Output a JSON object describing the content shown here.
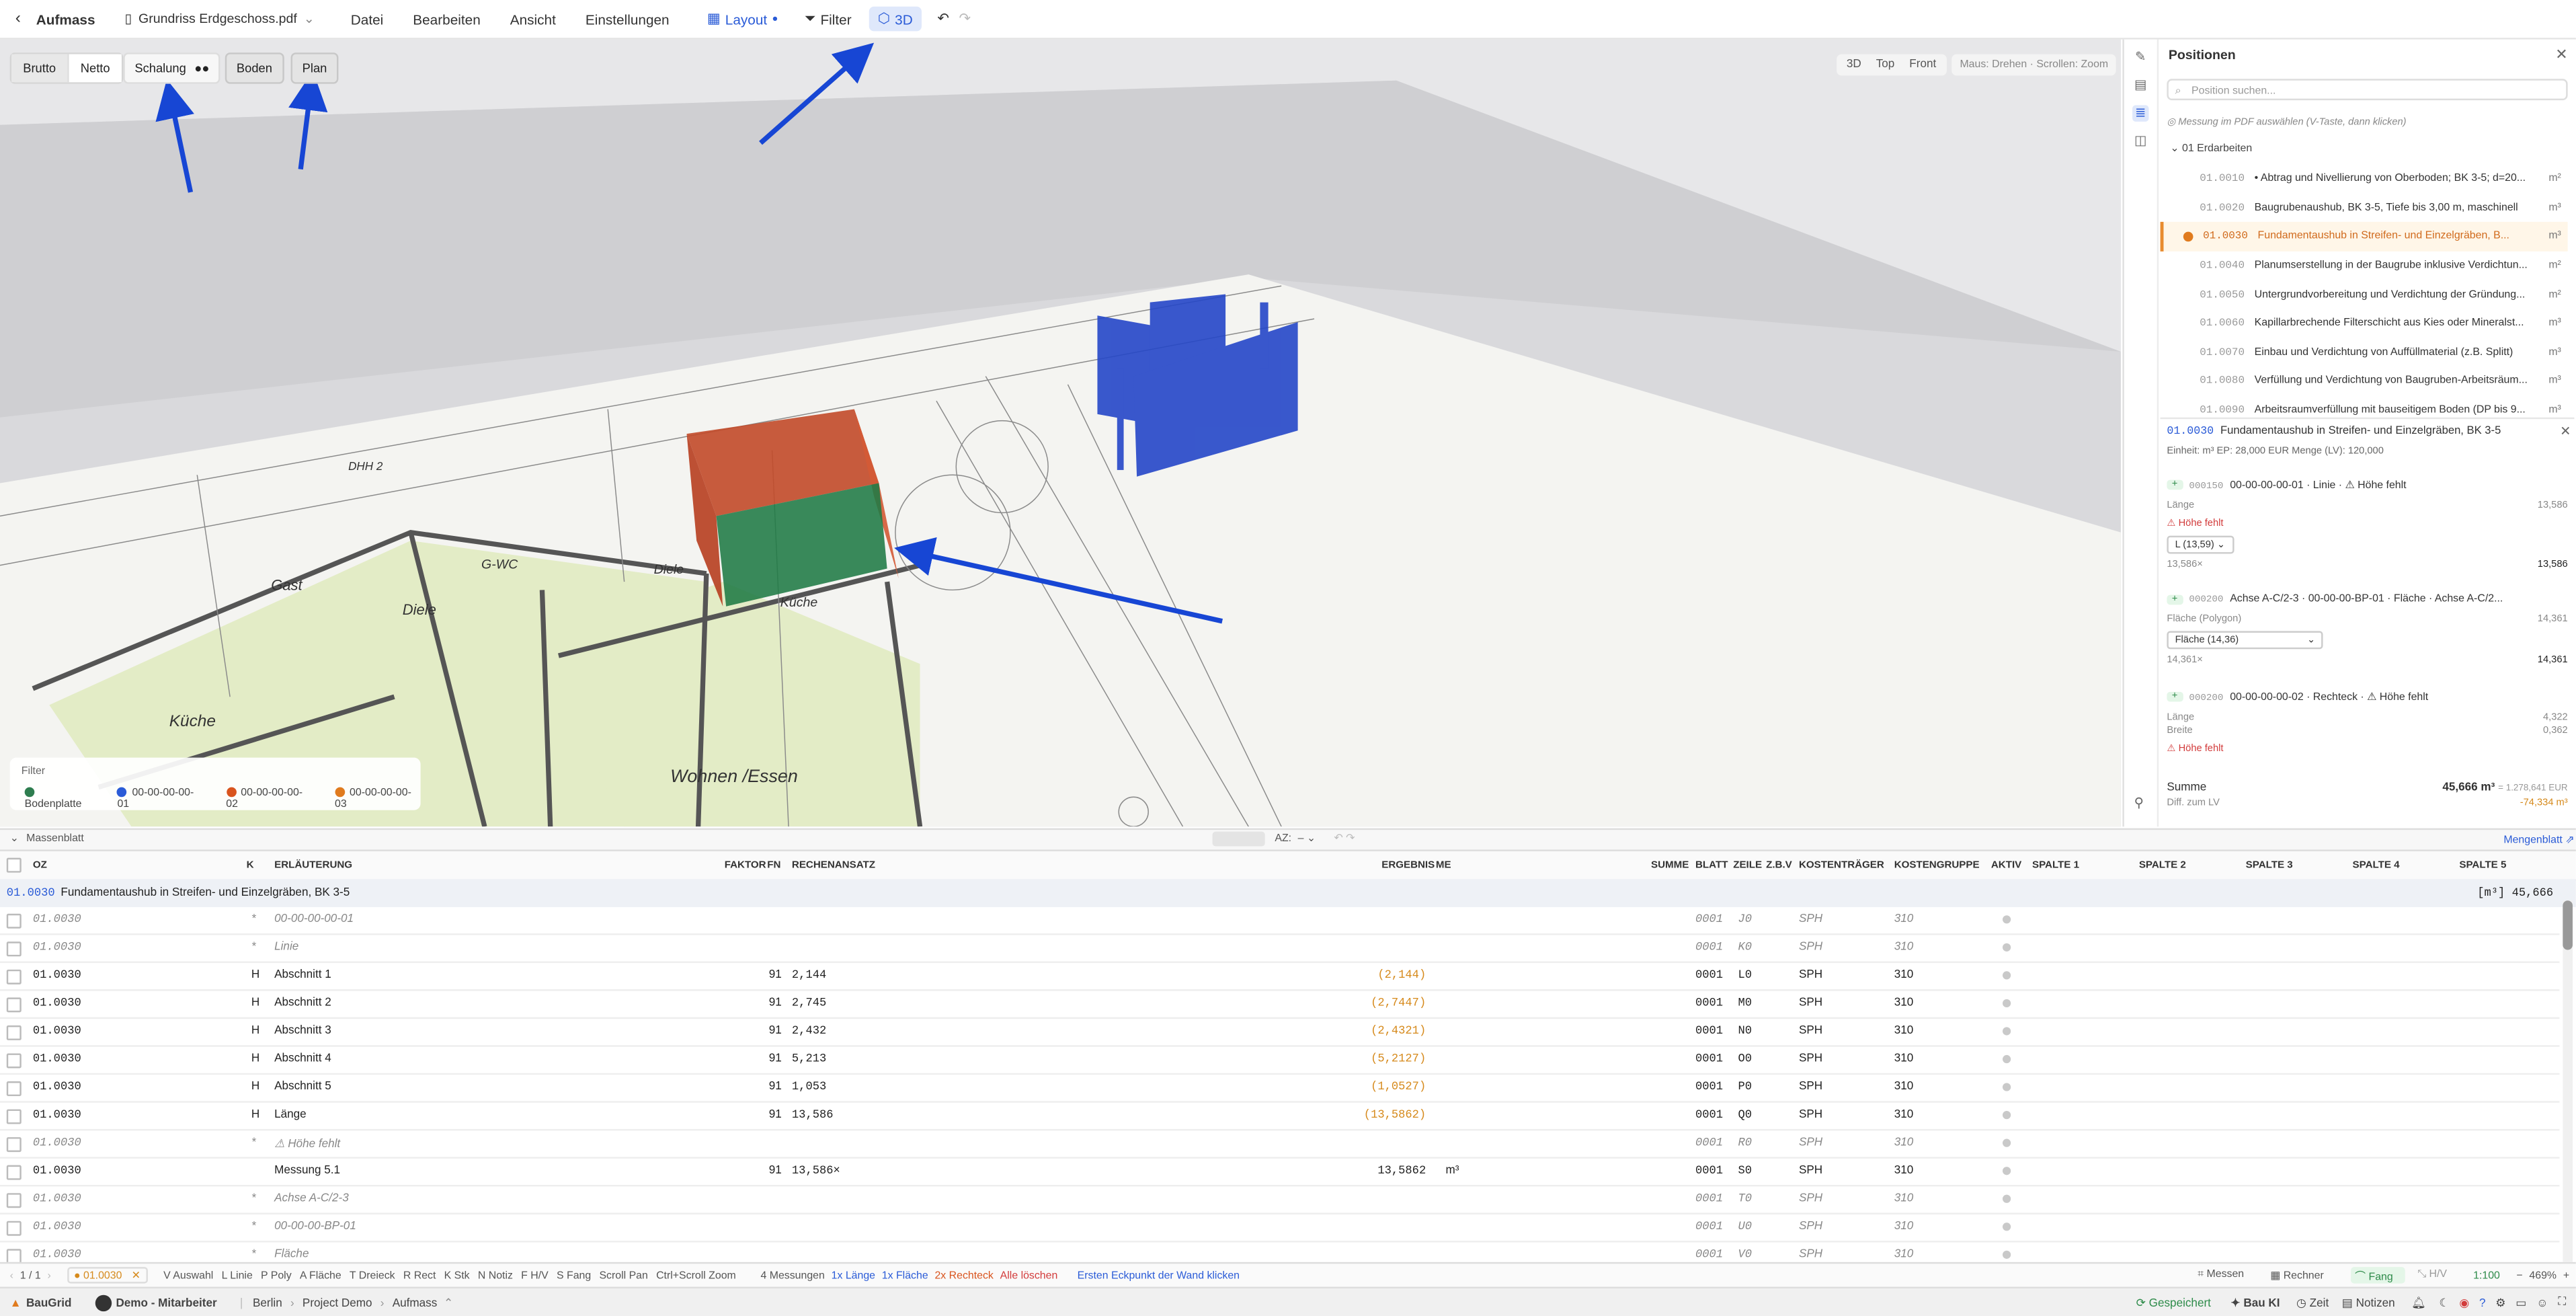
{
  "topbar": {
    "app_title": "Aufmass",
    "file_name": "Grundriss Erdgeschoss.pdf",
    "menus": [
      "Datei",
      "Bearbeiten",
      "Ansicht",
      "Einstellungen"
    ],
    "layout_label": "Layout",
    "filter_label": "Filter",
    "view3d_label": "3D"
  },
  "viewport": {
    "mode_buttons": [
      "Brutto",
      "Netto"
    ],
    "schalung_label": "Schalung",
    "boden_label": "Boden",
    "plan_label": "Plan",
    "view_tabs": [
      "3D",
      "Top",
      "Front"
    ],
    "mouse_hint": "Maus: Drehen · Scrollen: Zoom",
    "rooms": [
      "Gast",
      "Diele",
      "G-WC",
      "Diele",
      "Küche",
      "Küche",
      "Wohnen /Essen",
      "DHH 2"
    ],
    "filter": {
      "title": "Filter",
      "items": [
        {
          "label": "Bodenplatte",
          "color": "#2e7d4f"
        },
        {
          "label": "00-00-00-00-01",
          "color": "#2a5bd7"
        },
        {
          "label": "00-00-00-00-02",
          "color": "#d9541e"
        },
        {
          "label": "00-00-00-00-03",
          "color": "#e07b1e"
        }
      ]
    }
  },
  "positions": {
    "title": "Positionen",
    "search_placeholder": "Position suchen...",
    "hint": "Messung im PDF auswählen (V-Taste, dann klicken)",
    "group": "01 Erdarbeiten",
    "items": [
      {
        "oz": "01.0010",
        "text": "• Abtrag und Nivellierung von Oberboden; BK 3-5; d=20...",
        "unit": "m²"
      },
      {
        "oz": "01.0020",
        "text": "Baugrubenaushub, BK 3-5, Tiefe bis 3,00 m, maschinell",
        "unit": "m³"
      },
      {
        "oz": "01.0030",
        "text": "Fundamentaushub in Streifen- und Einzelgräben, B...",
        "unit": "m³",
        "selected": true
      },
      {
        "oz": "01.0040",
        "text": "Planumserstellung in der Baugrube inklusive Verdichtun...",
        "unit": "m²"
      },
      {
        "oz": "01.0050",
        "text": "Untergrundvorbereitung und Verdichtung der Gründung...",
        "unit": "m²"
      },
      {
        "oz": "01.0060",
        "text": "Kapillarbrechende Filterschicht aus Kies oder Mineralst...",
        "unit": "m³"
      },
      {
        "oz": "01.0070",
        "text": "Einbau und Verdichtung von Auffüllmaterial (z.B. Splitt)",
        "unit": "m³"
      },
      {
        "oz": "01.0080",
        "text": "Verfüllung und Verdichtung von Baugruben-Arbeitsräum...",
        "unit": "m³"
      },
      {
        "oz": "01.0090",
        "text": "Arbeitsraumverfüllung mit bauseitigem Boden (DP bis 9...",
        "unit": "m³"
      }
    ],
    "detail": {
      "oz": "01.0030",
      "title": "Fundamentaushub in Streifen- und Einzelgräben, BK 3-5",
      "meta": "Einheit: m³   EP: 28,000 EUR   Menge (LV): 120,000",
      "cards": [
        {
          "num": "000150",
          "name": "00-00-00-00-01 · Linie · ⚠ Höhe fehlt",
          "l1": "Länge",
          "v1": "13,586",
          "warn": "⚠ Höhe fehlt",
          "select": "L (13,59)",
          "formula": "13,586×",
          "result": "13,586"
        },
        {
          "num": "000200",
          "name": "Achse A-C/2-3 · 00-00-00-BP-01 · Fläche · Achse A-C/2...",
          "l1": "Fläche (Polygon)",
          "v1": "14,361",
          "select": "Fläche (14,36)",
          "formula": "14,361×",
          "result": "14,361"
        },
        {
          "num": "000200",
          "name": "00-00-00-00-02 · Rechteck · ⚠ Höhe fehlt",
          "l1": "Länge",
          "v1": "4,322",
          "l2": "Breite",
          "v2": "0,362",
          "warn": "⚠ Höhe fehlt"
        }
      ]
    },
    "sum_label": "Summe",
    "sum_value": "45,666 m³",
    "sum_eur": "= 1.278,641 EUR",
    "diff_label": "Diff. zum LV",
    "diff_value": "-74,334 m³"
  },
  "massenblatt": {
    "title": "Massenblatt",
    "sort_label": "AZ:",
    "link": "Mengenblatt",
    "headers": {
      "oz": "OZ",
      "k": "K",
      "erl": "ERLÄUTERUNG",
      "faktor": "FAKTOR",
      "fn": "FN",
      "rech": "RECHENANSATZ",
      "erg": "ERGEBNIS",
      "me": "ME",
      "summe": "SUMME",
      "blatt": "BLATT",
      "zeile": "ZEILE",
      "zbv": "Z.B.V",
      "kt": "KOSTENTRÄGER",
      "kg": "KOSTENGRUPPE",
      "aktiv": "AKTIV",
      "s1": "SPALTE 1",
      "s2": "SPALTE 2",
      "s3": "SPALTE 3",
      "s4": "SPALTE 4",
      "s5": "SPALTE 5"
    },
    "group": {
      "oz": "01.0030",
      "title": "Fundamentaushub in Streifen- und Einzelgräben, BK 3-5",
      "right": "[m³] 45,666"
    },
    "rows": [
      {
        "oz": "01.0030",
        "k": "*",
        "erl": "00-00-00-00-01",
        "fn": "",
        "rech": "",
        "erg": "",
        "me": "",
        "blatt": "0001",
        "zeile": "J0",
        "kt": "SPH",
        "kg": "310",
        "italic": true
      },
      {
        "oz": "01.0030",
        "k": "*",
        "erl": "Linie",
        "fn": "",
        "rech": "",
        "erg": "",
        "me": "",
        "blatt": "0001",
        "zeile": "K0",
        "kt": "SPH",
        "kg": "310",
        "italic": true
      },
      {
        "oz": "01.0030",
        "k": "H",
        "erl": "Abschnitt 1",
        "fn": "91",
        "rech": "2,144",
        "erg": "(2,144)",
        "me": "",
        "blatt": "0001",
        "zeile": "L0",
        "kt": "SPH",
        "kg": "310",
        "orange": true
      },
      {
        "oz": "01.0030",
        "k": "H",
        "erl": "Abschnitt 2",
        "fn": "91",
        "rech": "2,745",
        "erg": "(2,7447)",
        "me": "",
        "blatt": "0001",
        "zeile": "M0",
        "kt": "SPH",
        "kg": "310",
        "orange": true
      },
      {
        "oz": "01.0030",
        "k": "H",
        "erl": "Abschnitt 3",
        "fn": "91",
        "rech": "2,432",
        "erg": "(2,4321)",
        "me": "",
        "blatt": "0001",
        "zeile": "N0",
        "kt": "SPH",
        "kg": "310",
        "orange": true
      },
      {
        "oz": "01.0030",
        "k": "H",
        "erl": "Abschnitt 4",
        "fn": "91",
        "rech": "5,213",
        "erg": "(5,2127)",
        "me": "",
        "blatt": "0001",
        "zeile": "O0",
        "kt": "SPH",
        "kg": "310",
        "orange": true
      },
      {
        "oz": "01.0030",
        "k": "H",
        "erl": "Abschnitt 5",
        "fn": "91",
        "rech": "1,053",
        "erg": "(1,0527)",
        "me": "",
        "blatt": "0001",
        "zeile": "P0",
        "kt": "SPH",
        "kg": "310",
        "orange": true
      },
      {
        "oz": "01.0030",
        "k": "H",
        "erl": "Länge",
        "fn": "91",
        "rech": "13,586",
        "erg": "(13,5862)",
        "me": "",
        "blatt": "0001",
        "zeile": "Q0",
        "kt": "SPH",
        "kg": "310",
        "orange": true
      },
      {
        "oz": "01.0030",
        "k": "*",
        "erl": "⚠ Höhe fehlt",
        "fn": "",
        "rech": "",
        "erg": "",
        "me": "",
        "blatt": "0001",
        "zeile": "R0",
        "kt": "SPH",
        "kg": "310",
        "italic": true
      },
      {
        "oz": "01.0030",
        "k": "",
        "erl": "Messung 5.1",
        "fn": "91",
        "rech": "13,586×",
        "erg": "13,5862",
        "me": "m³",
        "blatt": "0001",
        "zeile": "S0",
        "kt": "SPH",
        "kg": "310"
      },
      {
        "oz": "01.0030",
        "k": "*",
        "erl": "Achse A-C/2-3",
        "fn": "",
        "rech": "",
        "erg": "",
        "me": "",
        "blatt": "0001",
        "zeile": "T0",
        "kt": "SPH",
        "kg": "310",
        "italic": true
      },
      {
        "oz": "01.0030",
        "k": "*",
        "erl": "00-00-00-BP-01",
        "fn": "",
        "rech": "",
        "erg": "",
        "me": "",
        "blatt": "0001",
        "zeile": "U0",
        "kt": "SPH",
        "kg": "310",
        "italic": true
      },
      {
        "oz": "01.0030",
        "k": "*",
        "erl": "Fläche",
        "fn": "",
        "rech": "",
        "erg": "",
        "me": "",
        "blatt": "0001",
        "zeile": "V0",
        "kt": "SPH",
        "kg": "310",
        "italic": true
      }
    ]
  },
  "bottomtools": {
    "page": "1 / 1",
    "current_pos": "01.0030",
    "tools": [
      "V Auswahl",
      "L Linie",
      "P Poly",
      "A Fläche",
      "T Dreieck",
      "R Rect",
      "K Stk",
      "N Notiz",
      "F H/V",
      "S Fang",
      "Scroll Pan",
      "Ctrl+Scroll Zoom"
    ],
    "count": "4 Messungen",
    "c1": "1x Länge",
    "c2": "1x Fläche",
    "c3": "2x Rechteck",
    "clear": "Alle löschen",
    "hint": "Ersten Eckpunkt der Wand klicken",
    "right_tools": [
      "Messen",
      "Rechner",
      "Fang",
      "H/V"
    ],
    "scale": "1:100",
    "zoom": "469%"
  },
  "statusbar": {
    "brand": "BauGrid",
    "user": "Demo - Mitarbeiter",
    "crumbs": [
      "Berlin",
      "Project Demo",
      "Aufmass"
    ],
    "saved": "Gespeichert",
    "ai": "Bau KI",
    "time": "Zeit",
    "notes": "Notizen"
  }
}
